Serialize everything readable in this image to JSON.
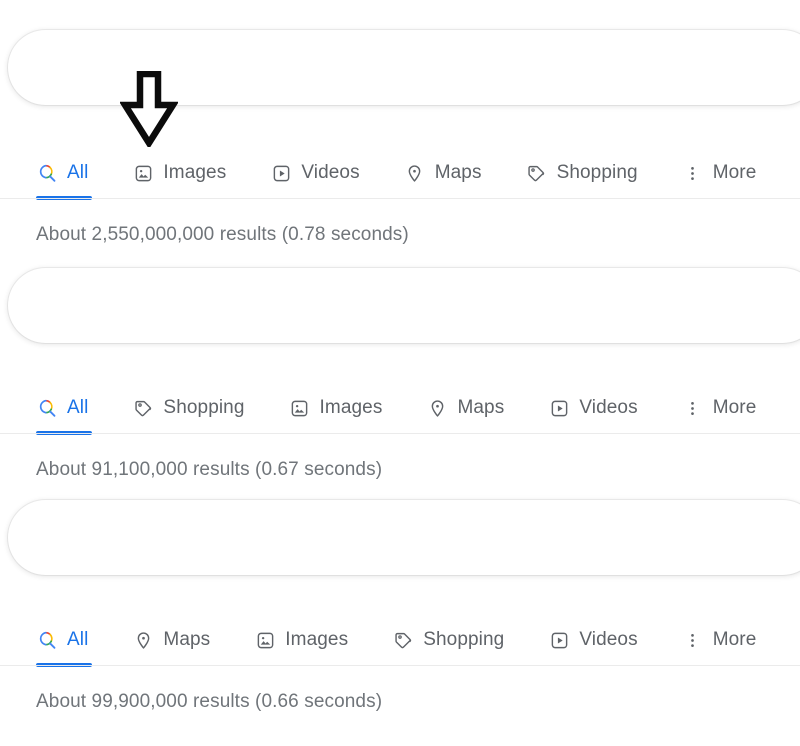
{
  "colors": {
    "accent": "#1a73e8",
    "tab_text": "#5f6368",
    "stat_text": "#70757a",
    "divider": "#ebebeb",
    "background": "#ffffff",
    "arrow": "#000000",
    "google_blue": "#4285f4",
    "google_red": "#ea4335",
    "google_yellow": "#fbbc05",
    "google_green": "#34a853"
  },
  "annotation": {
    "arrow_icon": "arrow-down-icon",
    "points_at": "images-tab"
  },
  "blocks": [
    {
      "search": {
        "value": "",
        "placeholder": ""
      },
      "tabs": [
        {
          "label": "All",
          "icon": "google-search-icon",
          "active": true
        },
        {
          "label": "Images",
          "icon": "image-icon",
          "active": false
        },
        {
          "label": "Videos",
          "icon": "video-icon",
          "active": false
        },
        {
          "label": "Maps",
          "icon": "map-pin-icon",
          "active": false
        },
        {
          "label": "Shopping",
          "icon": "tag-icon",
          "active": false
        },
        {
          "label": "More",
          "icon": "more-vertical-icon",
          "active": false
        }
      ],
      "results_stat": "About 2,550,000,000 results (0.78 seconds)"
    },
    {
      "search": {
        "value": "",
        "placeholder": ""
      },
      "tabs": [
        {
          "label": "All",
          "icon": "google-search-icon",
          "active": true
        },
        {
          "label": "Shopping",
          "icon": "tag-icon",
          "active": false
        },
        {
          "label": "Images",
          "icon": "image-icon",
          "active": false
        },
        {
          "label": "Maps",
          "icon": "map-pin-icon",
          "active": false
        },
        {
          "label": "Videos",
          "icon": "video-icon",
          "active": false
        },
        {
          "label": "More",
          "icon": "more-vertical-icon",
          "active": false
        }
      ],
      "results_stat": "About 91,100,000 results (0.67 seconds)"
    },
    {
      "search": {
        "value": "",
        "placeholder": ""
      },
      "tabs": [
        {
          "label": "All",
          "icon": "google-search-icon",
          "active": true
        },
        {
          "label": "Maps",
          "icon": "map-pin-icon",
          "active": false
        },
        {
          "label": "Images",
          "icon": "image-icon",
          "active": false
        },
        {
          "label": "Shopping",
          "icon": "tag-icon",
          "active": false
        },
        {
          "label": "Videos",
          "icon": "video-icon",
          "active": false
        },
        {
          "label": "More",
          "icon": "more-vertical-icon",
          "active": false
        }
      ],
      "results_stat": "About 99,900,000 results (0.66 seconds)"
    }
  ]
}
